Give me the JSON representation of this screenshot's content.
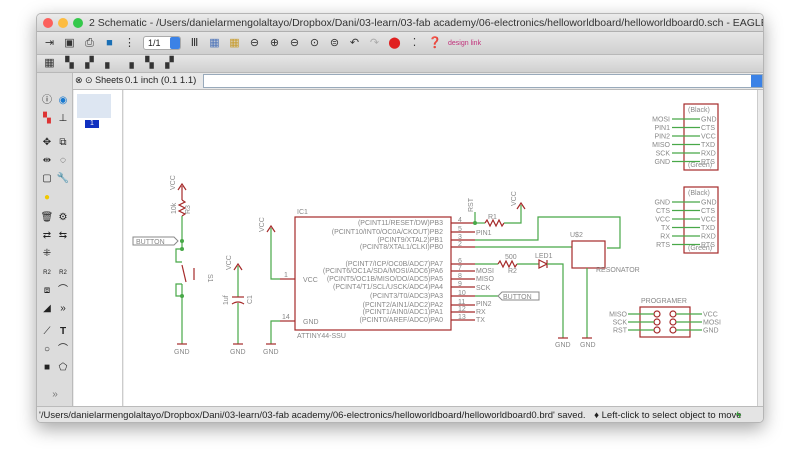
{
  "window": {
    "title": "2 Schematic - /Users/danielarmengolaltayo/Dropbox/Dani/03-learn/03-fab academy/06-electronics/helloworldboard/helloworldboard0.sch - EAGLE 7.2.0 Light"
  },
  "toolbar": {
    "sheet_select": "1/1",
    "design_link": "design link"
  },
  "command": {
    "grid_label": "0.1 inch (0.1 1.1)",
    "sheets_label": "Sheets",
    "input_value": ""
  },
  "sheets": {
    "items": [
      "1"
    ]
  },
  "status": {
    "message": "'/Users/danielarmengolaltayo/Dropbox/Dani/03-learn/03-fab academy/06-electronics/helloworldboard/helloworldboard0.brd' saved.",
    "hint": "♦ Left-click to select object to move"
  },
  "colors": {
    "wire": "#48a848",
    "part": "#a52a2a",
    "accent": "#3b82e6"
  },
  "schematic": {
    "ic": {
      "name": "IC1",
      "value": "ATTINY44-SSU",
      "pins_right": [
        {
          "num": "4",
          "label": "(PCINT11/RESET/DW)PB3"
        },
        {
          "num": "5",
          "label": "(PCINT10/INT0/OC0A/CKOUT)PB2"
        },
        {
          "num": "3",
          "label": "(PCINT9/XTAL2)PB1"
        },
        {
          "num": "2",
          "label": "(PCINT8/XTAL1/CLKI)PB0"
        },
        {
          "num": "6",
          "label": "(PCINT7/ICP/OC0B/ADC7)PA7"
        },
        {
          "num": "7",
          "label": "(PCINT6/OC1A/SDA/MOSI/ADC6)PA6"
        },
        {
          "num": "8",
          "label": "(PCINT5/OC1B/MISO/DO/ADC5)PA5"
        },
        {
          "num": "9",
          "label": "(PCINT4/T1/SCL/USCK/ADC4)PA4"
        },
        {
          "num": "10",
          "label": "(PCINT3/T0/ADC3)PA3"
        },
        {
          "num": "11",
          "label": "(PCINT2/AIN1/ADC2)PA2"
        },
        {
          "num": "12",
          "label": "(PCINT1/AIN0/ADC1)PA1"
        },
        {
          "num": "13",
          "label": "(PCINT0/AREF/ADC0)PA0"
        }
      ],
      "pins_left": [
        {
          "num": "1",
          "label": "VCC"
        },
        {
          "num": "14",
          "label": "GND"
        }
      ]
    },
    "nets": {
      "rst": "RST",
      "pin1": "PIN1",
      "mosi": "MOSI",
      "miso": "MISO",
      "sck": "SCK",
      "pin2": "PIN2",
      "rx": "RX",
      "tx": "TX",
      "button": "BUTTON",
      "vcc": "VCC",
      "gnd": "GND"
    },
    "r1": "R1",
    "r2": {
      "name": "R2",
      "value": "500"
    },
    "r3": {
      "name": "R3",
      "value": "10k"
    },
    "led": "LED1",
    "s1": "S1",
    "c1": {
      "name": "C1",
      "value": "1uf"
    },
    "resonator": {
      "name": "U$2",
      "value": "RESONATOR"
    },
    "header1": {
      "top": "(Black)",
      "bottom": "(Green)",
      "pins": [
        "GND",
        "CTS",
        "VCC",
        "TXD",
        "RXD",
        "RTS"
      ],
      "nets": [
        "MOSI",
        "PIN1",
        "PIN2",
        "MISO",
        "SCK",
        "GND"
      ]
    },
    "header2": {
      "top": "(Black)",
      "bottom": "(Green)",
      "pins": [
        "GND",
        "CTS",
        "VCC",
        "TXD",
        "RXD",
        "RTS"
      ],
      "nets": [
        "GND",
        "CTS",
        "VCC",
        "TX",
        "RX",
        "RTS"
      ]
    },
    "programer": {
      "name": "PROGRAMER",
      "left": [
        "MISO",
        "SCK",
        "RST"
      ],
      "right": [
        "VCC",
        "MOSI",
        "GND"
      ]
    }
  }
}
